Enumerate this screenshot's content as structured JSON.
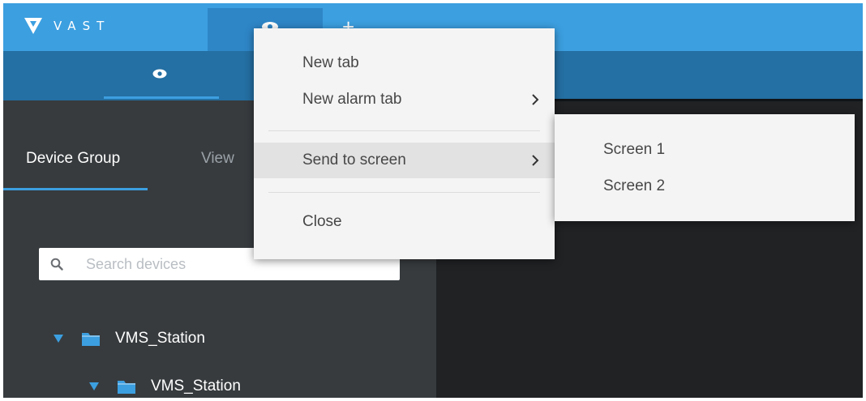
{
  "app": {
    "brand": "VAST"
  },
  "sidebar": {
    "tabs": [
      {
        "label": "Device Group"
      },
      {
        "label": "View"
      }
    ],
    "search": {
      "placeholder": "Search devices",
      "value": ""
    },
    "tree": [
      {
        "label": "VMS_Station"
      },
      {
        "label": "VMS_Station"
      }
    ]
  },
  "context_menu": {
    "items": [
      {
        "label": "New tab"
      },
      {
        "label": "New alarm tab"
      },
      {
        "label": "Send to screen"
      },
      {
        "label": "Close"
      }
    ]
  },
  "screen_submenu": {
    "items": [
      {
        "label": "Screen 1"
      },
      {
        "label": "Screen 2"
      }
    ]
  },
  "colors": {
    "accent": "#3c9fe0",
    "sub_header": "#246fa3",
    "sidebar": "#373b3e",
    "menu": "#f4f4f4"
  }
}
